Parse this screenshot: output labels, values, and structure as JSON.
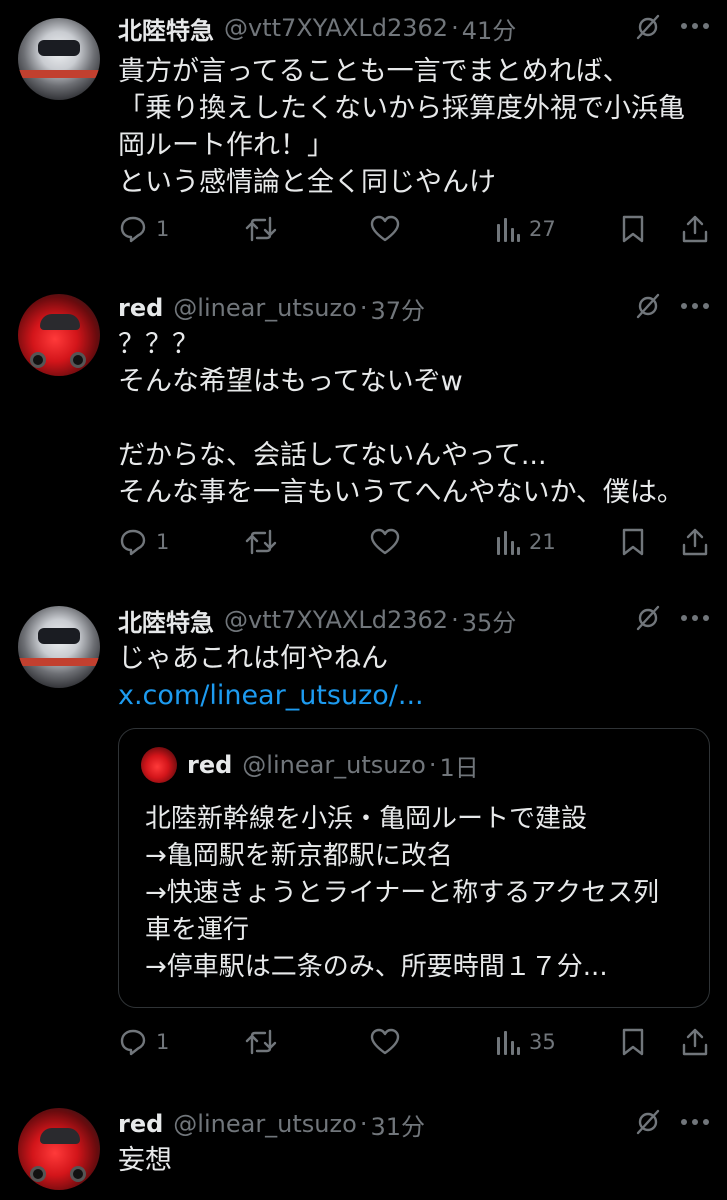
{
  "tweets": [
    {
      "author": "北陸特急",
      "handle": "@vtt7XYAXLd2362",
      "separator": "·",
      "time": "41分",
      "avatar": "train-photo",
      "lines": [
        "貴方が言ってることも一言でまとめれば、",
        "「乗り換えしたくないから採算度外視で小浜亀",
        "岡ルート作れ！」",
        "という感情論と全く同じやんけ"
      ],
      "replies": "1",
      "views": "27"
    },
    {
      "author": "red",
      "handle": "@linear_utsuzo",
      "separator": "·",
      "time": "37分",
      "avatar": "red-car-photo",
      "lines": [
        "？？？",
        "そんな希望はもってないぞw",
        "",
        "だからな、会話してないんやって...",
        "そんな事を一言もいうてへんやないか、僕は。"
      ],
      "replies": "1",
      "views": "21"
    },
    {
      "author": "北陸特急",
      "handle": "@vtt7XYAXLd2362",
      "separator": "·",
      "time": "35分",
      "avatar": "train-photo",
      "lines": [
        "じゃあこれは何やねん"
      ],
      "link": "x.com/linear_utsuzo/...",
      "quote": {
        "author": "red",
        "handle": "@linear_utsuzo",
        "separator": "·",
        "time": "1日",
        "lines": [
          "北陸新幹線を小浜・亀岡ルートで建設",
          "→亀岡駅を新京都駅に改名",
          "→快速きょうとライナーと称するアクセス列",
          "車を運行",
          "→停車駅は二条のみ、所要時間１７分..."
        ]
      },
      "replies": "1",
      "views": "35"
    },
    {
      "author": "red",
      "handle": "@linear_utsuzo",
      "separator": "·",
      "time": "31分",
      "avatar": "red-car-photo",
      "lines": [
        "妄想"
      ]
    }
  ],
  "icons": {
    "reply": "speech-bubble-icon",
    "retweet": "retweet-arrows-icon",
    "like": "heart-icon",
    "views": "bar-chart-icon",
    "bookmark": "bookmark-icon",
    "share": "share-upload-icon",
    "mute": "muted-bell-slash-icon",
    "more": "three-dots-icon"
  },
  "colors": {
    "background": "#000000",
    "text": "#e7e9ea",
    "secondary": "#71767b",
    "link": "#1d9bf0",
    "border": "#2f3336"
  }
}
